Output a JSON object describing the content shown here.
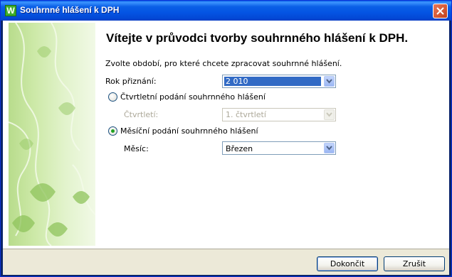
{
  "window": {
    "title": "Souhrnné hlášení k DPH",
    "app_icon_letter": "W"
  },
  "wizard": {
    "heading": "Vítejte v průvodci tvorby souhrnného hlášení k DPH.",
    "subtitle": "Zvolte období, pro které chcete zpracovat souhrnné hlášení.",
    "year": {
      "label": "Rok přiznání:",
      "value": "2 010"
    },
    "quarterly_option": {
      "label": "Čtvrtletní podání souhrnného hlášení",
      "selected": false
    },
    "quarter": {
      "label": "Čtvrtletí:",
      "value": "1. čtvrtletí",
      "enabled": false
    },
    "monthly_option": {
      "label": "Měsíční podání souhrnného hlášení",
      "selected": true
    },
    "month": {
      "label": "Měsíc:",
      "value": "Březen"
    }
  },
  "footer": {
    "finish_label": "Dokončit",
    "cancel_label": "Zrušit"
  },
  "colors": {
    "titlebar": "#0a5fe6",
    "selection": "#316ac5",
    "side_art_green": "#b8dc8c"
  }
}
